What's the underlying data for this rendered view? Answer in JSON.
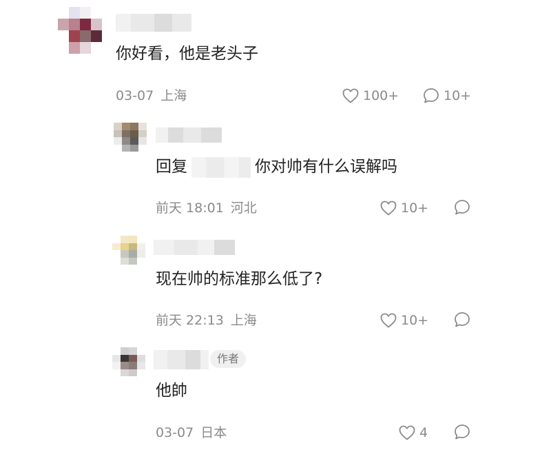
{
  "comments": [
    {
      "text": "你好看，他是老头子",
      "date": "03-07",
      "location": "上海",
      "likes": "100+",
      "replies": "10+"
    },
    {
      "reply_prefix": "回复",
      "text": "你对帅有什么误解吗",
      "date": "前天 18:01",
      "location": "河北",
      "likes": "10+"
    },
    {
      "text": "现在帅的标准那么低了?",
      "date": "前天 22:13",
      "location": "上海",
      "likes": "10+"
    },
    {
      "author_badge": "作者",
      "text": "他帥",
      "date": "03-07",
      "location": "日本",
      "likes": "4"
    }
  ],
  "icons": {
    "like": "heart-icon",
    "reply": "speech-bubble-icon"
  },
  "colors": {
    "text": "#222222",
    "meta": "#8a8a8a",
    "badge_bg": "#f0f0f0"
  }
}
